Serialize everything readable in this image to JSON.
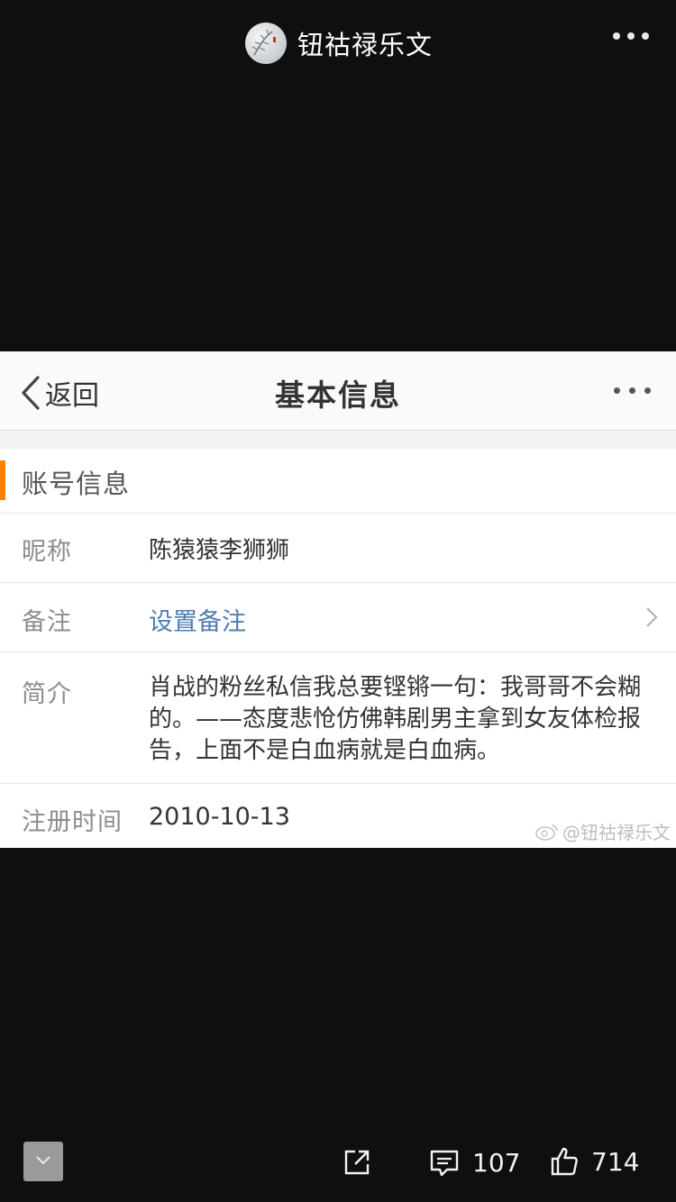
{
  "viewer": {
    "author_name": "钮祜禄乐文",
    "footer": {
      "comments": "107",
      "likes": "714"
    }
  },
  "profile_page": {
    "back_label": "返回",
    "title": "基本信息",
    "section_title": "账号信息",
    "rows": [
      {
        "label": "昵称",
        "value": "陈猿猿李狮狮"
      },
      {
        "label": "备注",
        "value": "设置备注"
      },
      {
        "label": "简介",
        "value": "肖战的粉丝私信我总要铿锵一句：我哥哥不会糊的。——态度悲怆仿佛韩剧男主拿到女友体检报告，上面不是白血病就是白血病。"
      },
      {
        "label": "注册时间",
        "value": "2010-10-13"
      }
    ],
    "watermark": "@钮祜禄乐文"
  },
  "colors": {
    "accent_orange": "#ff8200",
    "link_blue": "#507daf",
    "background": "#0f0f0f"
  },
  "icons": [
    "avatar",
    "more-icon",
    "back-chevron-icon",
    "chevron-right-icon",
    "weibo-logo-icon",
    "collapse-icon",
    "share-icon",
    "comment-icon",
    "like-icon"
  ]
}
